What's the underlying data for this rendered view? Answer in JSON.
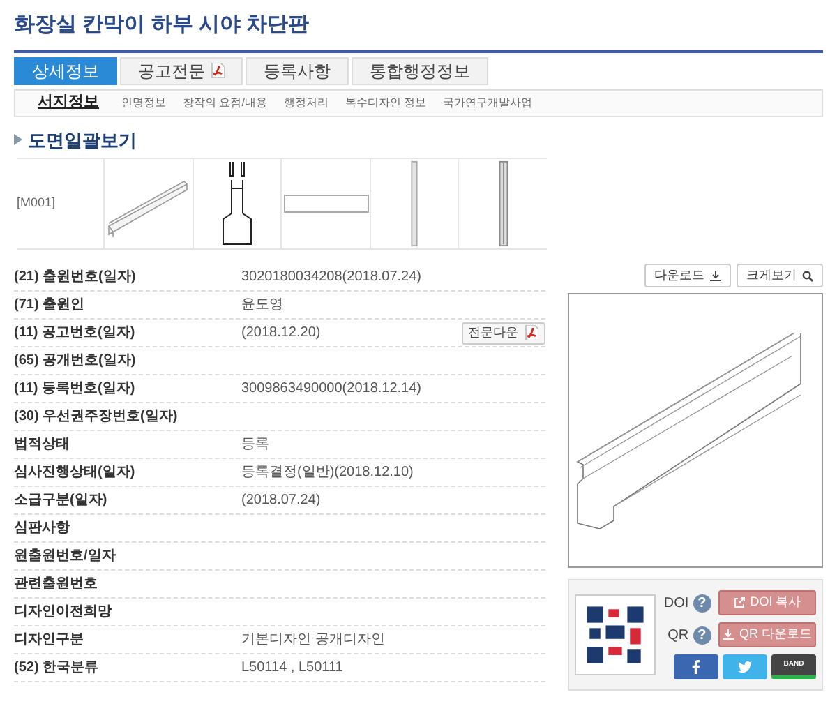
{
  "title": "화장실 칸막이 하부 시야 차단판",
  "tabs": [
    {
      "label": "상세정보",
      "selected": true,
      "pdf": false
    },
    {
      "label": "공고전문",
      "selected": false,
      "pdf": true
    },
    {
      "label": "등록사항",
      "selected": false,
      "pdf": false
    },
    {
      "label": "통합행정정보",
      "selected": false,
      "pdf": false
    }
  ],
  "subtabs": [
    {
      "label": "서지정보",
      "selected": true
    },
    {
      "label": "인명정보",
      "selected": false
    },
    {
      "label": "창작의 요점/내용",
      "selected": false
    },
    {
      "label": "행정처리",
      "selected": false
    },
    {
      "label": "복수디자인 정보",
      "selected": false
    },
    {
      "label": "국가연구개발사업",
      "selected": false
    }
  ],
  "drawings_section": {
    "heading": "도면일괄보기",
    "code": "[M001]"
  },
  "fields": [
    {
      "label": "(21) 출원번호(일자)",
      "value": "3020180034208(2018.07.24)"
    },
    {
      "label": "(71) 출원인",
      "value": "윤도영"
    },
    {
      "label": "(11) 공고번호(일자)",
      "value": "(2018.12.20)",
      "button": "전문다운"
    },
    {
      "label": "(65) 공개번호(일자)"
    },
    {
      "label": "(11) 등록번호(일자)",
      "value": "3009863490000(2018.12.14)"
    },
    {
      "label": "(30) 우선권주장번호(일자)"
    },
    {
      "label": "법적상태",
      "value": "등록"
    },
    {
      "label": "심사진행상태(일자)",
      "value": "등록결정(일반)(2018.12.10)"
    },
    {
      "label": "소급구분(일자)",
      "value": "(2018.07.24)"
    },
    {
      "label": "심판사항"
    },
    {
      "label": "원출원번호/일자"
    },
    {
      "label": "관련출원번호"
    },
    {
      "label": "디자인이전희망"
    },
    {
      "label": "디자인구분",
      "value": "기본디자인 공개디자인"
    },
    {
      "label": "(52) 한국분류",
      "value": "L50114 , L50111"
    }
  ],
  "image_panel": {
    "download": "다운로드",
    "zoom": "크게보기"
  },
  "share": {
    "help": "?",
    "doi_label": "DOI",
    "qr_label": "QR",
    "doi_button": "DOI 복사",
    "qr_button": "QR 다운로드",
    "band": "BAND"
  }
}
